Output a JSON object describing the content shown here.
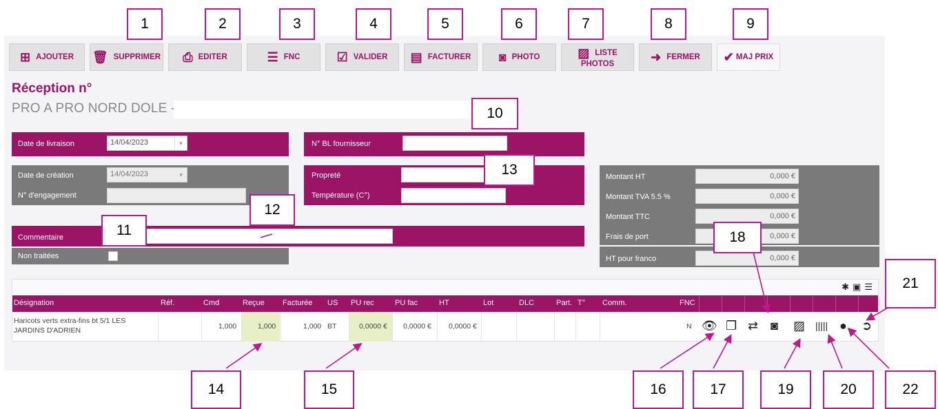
{
  "toolbar": {
    "ajouter": "AJOUTER",
    "supprimer": "SUPPRIMER",
    "editer": "EDITER",
    "fnc": "FNC",
    "valider": "VALIDER",
    "facturer": "FACTURER",
    "photo": "PHOTO",
    "liste_photos_1": "LISTE",
    "liste_photos_2": "PHOTOS",
    "fermer": "FERMER",
    "maj_prix": "MAJ PRIX"
  },
  "header": {
    "title": "Réception n°",
    "supplier": "PRO A PRO NORD DOLE -"
  },
  "form": {
    "date_livraison_label": "Date de livraison",
    "date_livraison_value": "14/04/2023",
    "bl_label": "N° BL fournisseur",
    "date_creation_label": "Date de création",
    "date_creation_value": "14/04/2023",
    "engagement_label": "N° d'engagement",
    "proprete_label": "Propreté",
    "temperature_label": "Température (C°)",
    "commentaire_label": "Commentaire",
    "non_traitees_label": "Non traitées"
  },
  "totals": {
    "montant_ht_label": "Montant HT",
    "montant_ht": "0,000 €",
    "tva_label": "Montant TVA 5.5 %",
    "tva": "0,000 €",
    "ttc_label": "Montant TTC",
    "ttc": "0,000 €",
    "frais_label": "Frais de port",
    "frais": "0,000 €",
    "franco_label": "HT pour franco",
    "franco": "0,000 €"
  },
  "table": {
    "columns": [
      "Désignation",
      "Réf.",
      "Cmd",
      "Reçue",
      "Facturée",
      "US",
      "PU rec",
      "PU fac",
      "HT",
      "Lot",
      "DLC",
      "Part.",
      "T°",
      "Comm.",
      "FNC"
    ],
    "row": {
      "designation_1": "Haricots verts extra-fins bt 5/1 LES",
      "designation_2": "JARDINS D'ADRIEN",
      "cmd": "1,000",
      "recue": "1,000",
      "facturee": "1,000",
      "us": "BT",
      "pu_rec": "0,0000 €",
      "pu_fac": "0,0000 €",
      "ht": "0,0000 €",
      "fnc": "N"
    }
  },
  "callouts": [
    "1",
    "2",
    "3",
    "4",
    "5",
    "6",
    "7",
    "8",
    "9",
    "10",
    "11",
    "12",
    "13",
    "14",
    "15",
    "16",
    "17",
    "18",
    "19",
    "20",
    "21",
    "22"
  ],
  "colors": {
    "accent": "#9b1466",
    "panel_gray": "#7a7a7a",
    "callout_border": "#c2178c",
    "highlight": "#e7efc6"
  }
}
